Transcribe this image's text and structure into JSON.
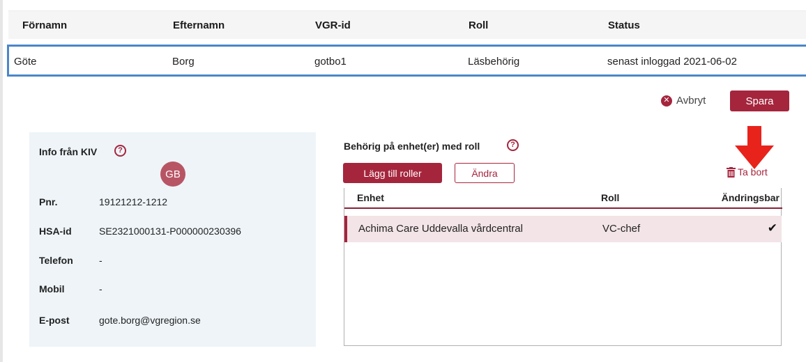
{
  "user_table": {
    "headers": [
      "Förnamn",
      "Efternamn",
      "VGR-id",
      "Roll",
      "Status"
    ],
    "row": {
      "first_name": "Göte",
      "last_name": "Borg",
      "vgr_id": "gotbo1",
      "role": "Läsbehörig",
      "status": "senast inloggad 2021-06-02"
    }
  },
  "actions": {
    "cancel_label": "Avbryt",
    "save_label": "Spara"
  },
  "kiv": {
    "title": "Info från KIV",
    "help": "?",
    "avatar_initials": "GB",
    "fields": [
      {
        "label": "Pnr.",
        "value": "19121212-1212"
      },
      {
        "label": "HSA-id",
        "value": "SE2321000131-P000000230396"
      },
      {
        "label": "Telefon",
        "value": "-"
      },
      {
        "label": "Mobil",
        "value": "-"
      },
      {
        "label": "E-post",
        "value": "gote.borg@vgregion.se"
      }
    ]
  },
  "roles": {
    "title": "Behörig på enhet(er) med roll",
    "help": "?",
    "add_label": "Lägg till roller",
    "edit_label": "Ändra",
    "delete_label": "Ta bort",
    "headers": [
      "Enhet",
      "Roll",
      "Ändringsbar"
    ],
    "rows": [
      {
        "unit": "Achima Care Uddevalla vårdcentral",
        "role": "VC-chef",
        "editable": "✔"
      }
    ]
  },
  "colors": {
    "accent": "#a5253d",
    "selected_row_border": "#4a86c8",
    "arrow": "#e8231c",
    "panel_bg": "#eef4f8",
    "avatar_bg": "#b85565"
  },
  "icons": {
    "cancel": "x-circle-icon",
    "help": "question-circle-icon",
    "delete": "trash-icon",
    "editable": "checkmark-icon",
    "annotation": "red-down-arrow"
  }
}
